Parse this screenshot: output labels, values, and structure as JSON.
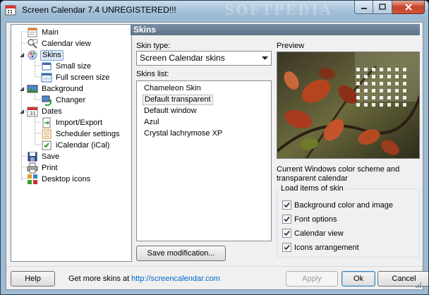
{
  "window": {
    "title": "Screen Calendar 7.4 UNREGISTERED!!!",
    "watermark": "SOFTPEDIA"
  },
  "tree": {
    "items": [
      {
        "label": "Main",
        "icon": "home-page-icon",
        "level": 1
      },
      {
        "label": "Calendar view",
        "icon": "calendar-view-icon",
        "level": 1
      },
      {
        "label": "Skins",
        "icon": "skins-icon",
        "level": 1,
        "selected": true
      },
      {
        "label": "Small size",
        "icon": "small-window-icon",
        "level": 2
      },
      {
        "label": "Full screen size",
        "icon": "fullscreen-window-icon",
        "level": 2
      },
      {
        "label": "Background",
        "icon": "background-icon",
        "level": 1
      },
      {
        "label": "Changer",
        "icon": "changer-icon",
        "level": 2
      },
      {
        "label": "Dates",
        "icon": "dates-icon",
        "level": 1
      },
      {
        "label": "Import/Export",
        "icon": "import-export-icon",
        "level": 2
      },
      {
        "label": "Scheduler settings",
        "icon": "scheduler-icon",
        "level": 2
      },
      {
        "label": "iCalendar (iCal)",
        "icon": "ical-icon",
        "level": 2
      },
      {
        "label": "Save",
        "icon": "save-icon",
        "level": 1
      },
      {
        "label": "Print",
        "icon": "print-icon",
        "level": 1
      },
      {
        "label": "Desktop icons",
        "icon": "desktop-icons-icon",
        "level": 1
      }
    ]
  },
  "panel": {
    "header": "Skins",
    "skin_type_label": "Skin type:",
    "skin_type_value": "Screen Calendar skins",
    "skins_list_label": "Skins list:",
    "skins": [
      "Chameleon Skin",
      "Default transparent",
      "Default window",
      "Azul",
      "Crystal lachrymose XP"
    ],
    "selected_skin": "Default transparent",
    "save_modification": "Save modification...",
    "preview_label": "Preview",
    "description_line1": "Current Windows color scheme and",
    "description_line2": "transparent calendar",
    "load_items_title": "Load items of skin",
    "load_items": [
      {
        "label": "Background color and image",
        "checked": true
      },
      {
        "label": "Font options",
        "checked": true
      },
      {
        "label": "Calendar view",
        "checked": true
      },
      {
        "label": "Icons arrangement",
        "checked": true
      }
    ]
  },
  "footer": {
    "help": "Help",
    "more_skins_text": "Get more skins at",
    "more_skins_link": "http://screencalendar.com",
    "apply": "Apply",
    "ok": "Ok",
    "cancel": "Cancel"
  },
  "colors": {
    "selection": "#dce9f8",
    "link": "#0066cc",
    "panel_header": "#6a8096"
  }
}
